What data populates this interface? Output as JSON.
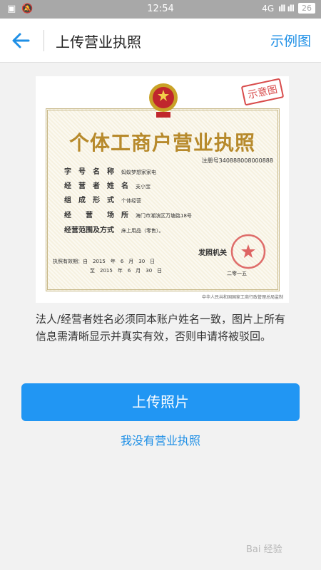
{
  "status_bar": {
    "time": "12:54",
    "network": "4G",
    "signal": "ıll ıll",
    "battery": "26"
  },
  "nav": {
    "title": "上传营业执照",
    "action": "示例图"
  },
  "license": {
    "stamp": "示意图",
    "title": "个体工商户营业执照",
    "reg_no": "注册号340888008000888",
    "fields": [
      {
        "label": "字　号　名　称",
        "value": "蚂蚁梦想家家电"
      },
      {
        "label": "经　营　者　姓　名",
        "value": "支小宝"
      },
      {
        "label": "组　成　形　式",
        "value": "个体经营"
      },
      {
        "label": "经　　营　　场　所",
        "value": "海门市潮滨区万塘路18号"
      },
      {
        "label": "经营范围及方式",
        "value": "床上用品（零售）。"
      }
    ],
    "valid_from": "执照有效期：自　2015　年　6　月　30　日",
    "valid_to": "至　2015　年　6　月　30　日",
    "issuer": "发照机关",
    "issue_date": "二零一五",
    "footer": "中华人民共和国国家工商行政管理总局监制"
  },
  "notice": "法人/经营者姓名必须同本账户姓名一致，图片上所有信息需清晰显示并真实有效，否则申请将被驳回。",
  "upload_button": "上传照片",
  "no_license_link": "我没有营业执照",
  "watermark": "Bai 经验"
}
